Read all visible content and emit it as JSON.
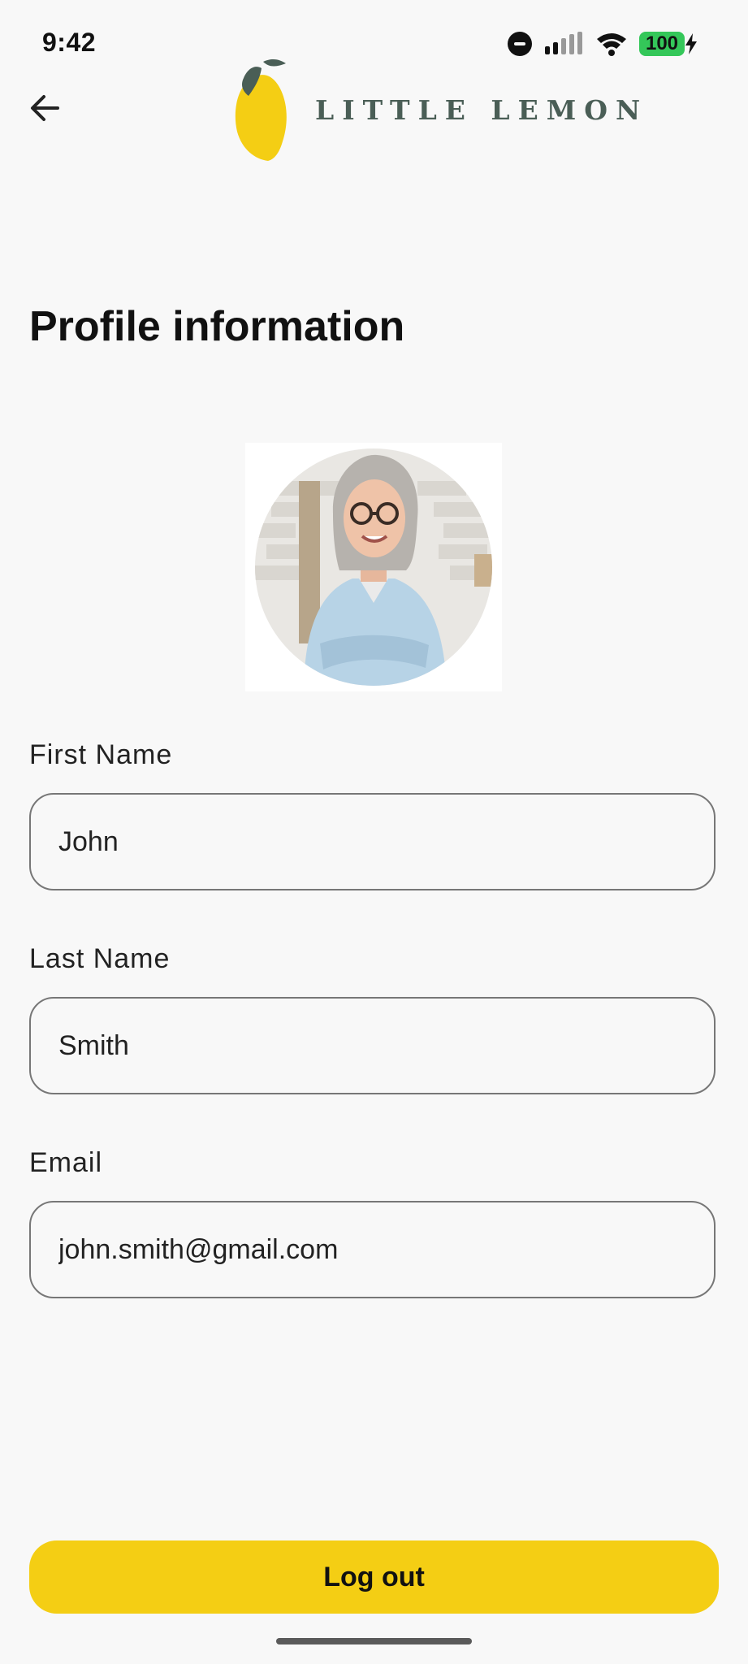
{
  "status_bar": {
    "time": "9:42",
    "battery": "100"
  },
  "header": {
    "brand": "LITTLE LEMON"
  },
  "page": {
    "title": "Profile information"
  },
  "form": {
    "first_name": {
      "label": "First Name",
      "value": "John"
    },
    "last_name": {
      "label": "Last Name",
      "value": "Smith"
    },
    "email": {
      "label": "Email",
      "value": "john.smith@gmail.com"
    }
  },
  "actions": {
    "logout_label": "Log out"
  },
  "colors": {
    "accent_yellow": "#F4CE14",
    "brand_green": "#4A5E56",
    "background": "#F8F8F8",
    "battery_green": "#34C759"
  },
  "icons": {
    "back": "arrow-back-icon",
    "dnd": "do-not-disturb-icon",
    "signal": "cellular-signal-icon",
    "wifi": "wifi-icon",
    "battery": "battery-charging-icon"
  }
}
